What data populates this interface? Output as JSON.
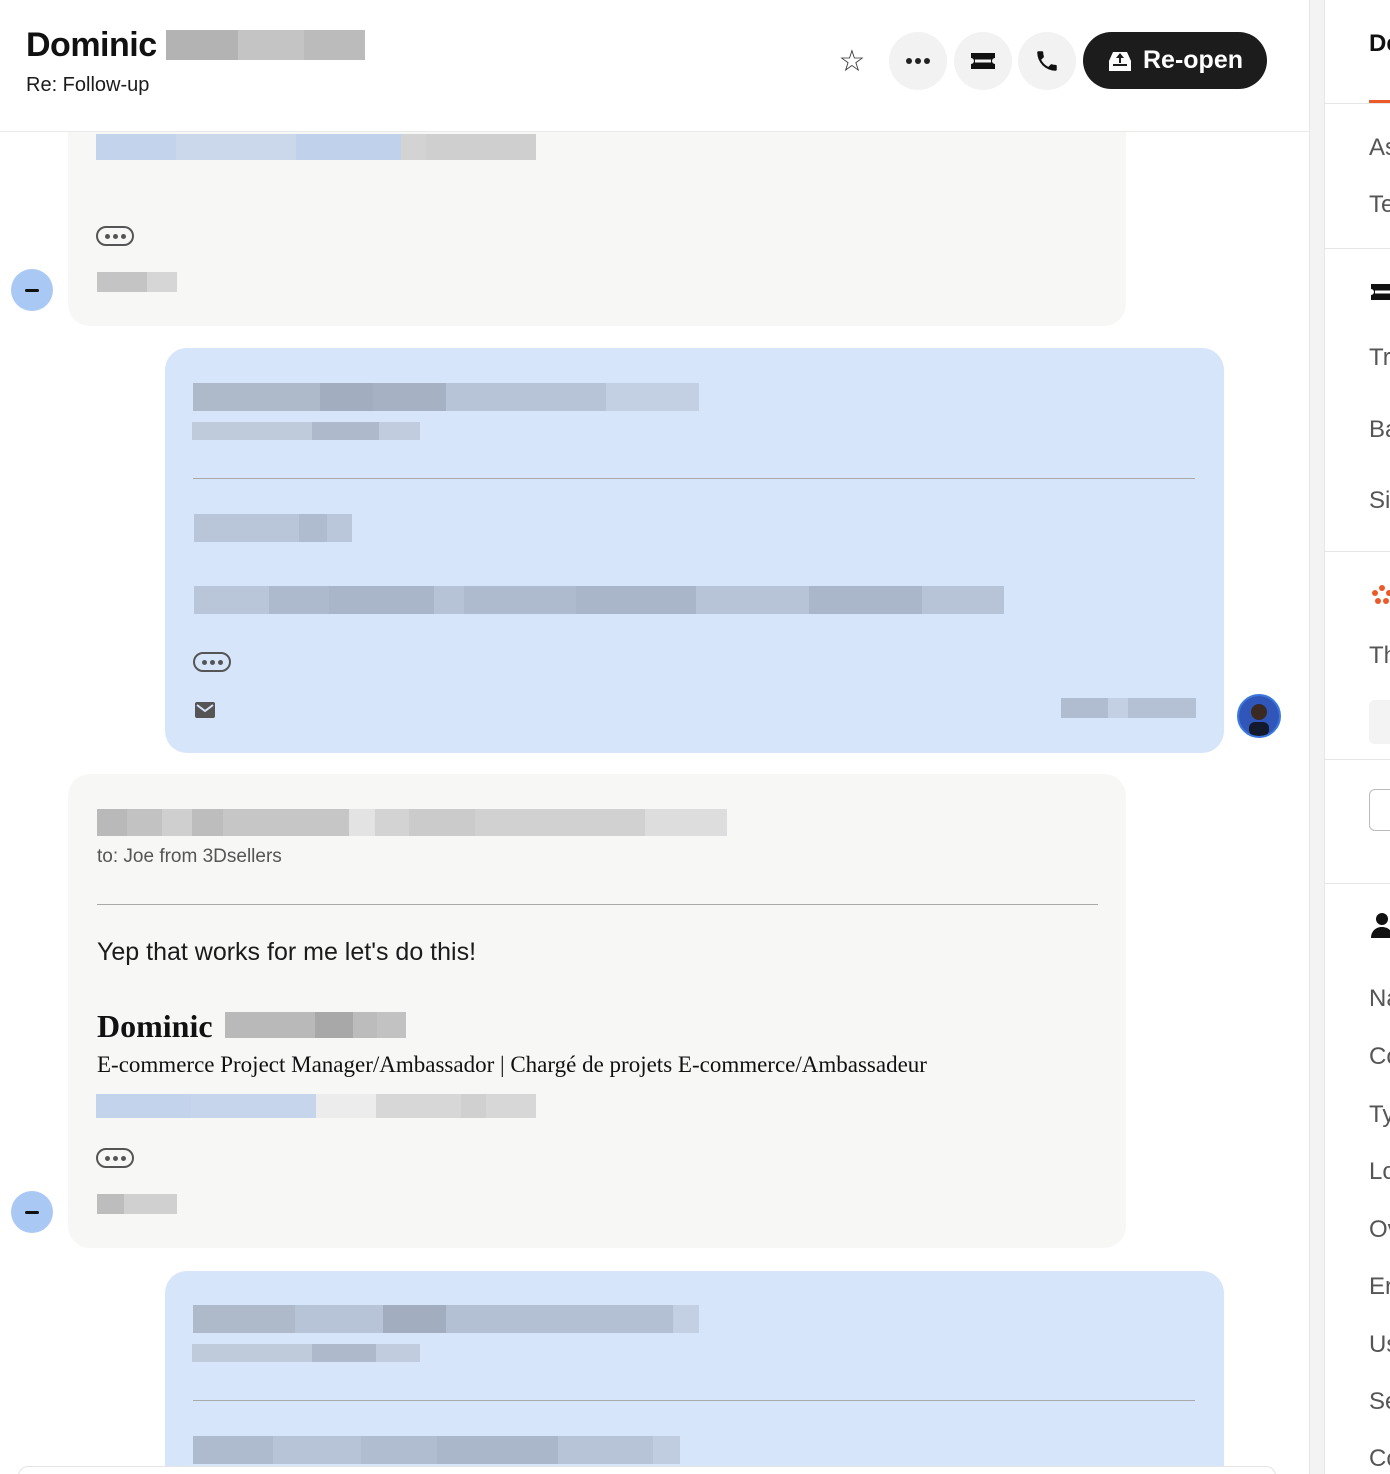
{
  "header": {
    "contact_name": "Dominic",
    "subject": "Re: Follow-up",
    "reopen_label": "Re-open"
  },
  "messages": {
    "message_3": {
      "to_line": "to: Joe from 3Dsellers",
      "body": "Yep that works for me let's do this!",
      "signature_name": "Dominic",
      "signature_title": "E-commerce Project Manager/Ambassador | Chargé de projets E-commerce/Ambassadeur"
    }
  },
  "side_panel": {
    "tab_label": "De",
    "items": [
      "As",
      "Te",
      "Tr",
      "Ba",
      "Si",
      "Th",
      "Na",
      "Co",
      "Ty",
      "Lo",
      "Ov",
      "Er",
      "Us",
      "Se",
      "Co"
    ]
  },
  "colors": {
    "accent": "#ec5a2a",
    "reopen_bg": "#1c1c1c",
    "agent_bubble": "#d7e5fb",
    "customer_bubble": "#f7f7f6",
    "collapse_button": "#a9c8f4"
  },
  "icons": [
    "star-icon",
    "more-icon",
    "ticket-icon",
    "phone-icon",
    "reopen-icon",
    "envelope-icon",
    "person-icon",
    "zendesk-logo-icon"
  ]
}
